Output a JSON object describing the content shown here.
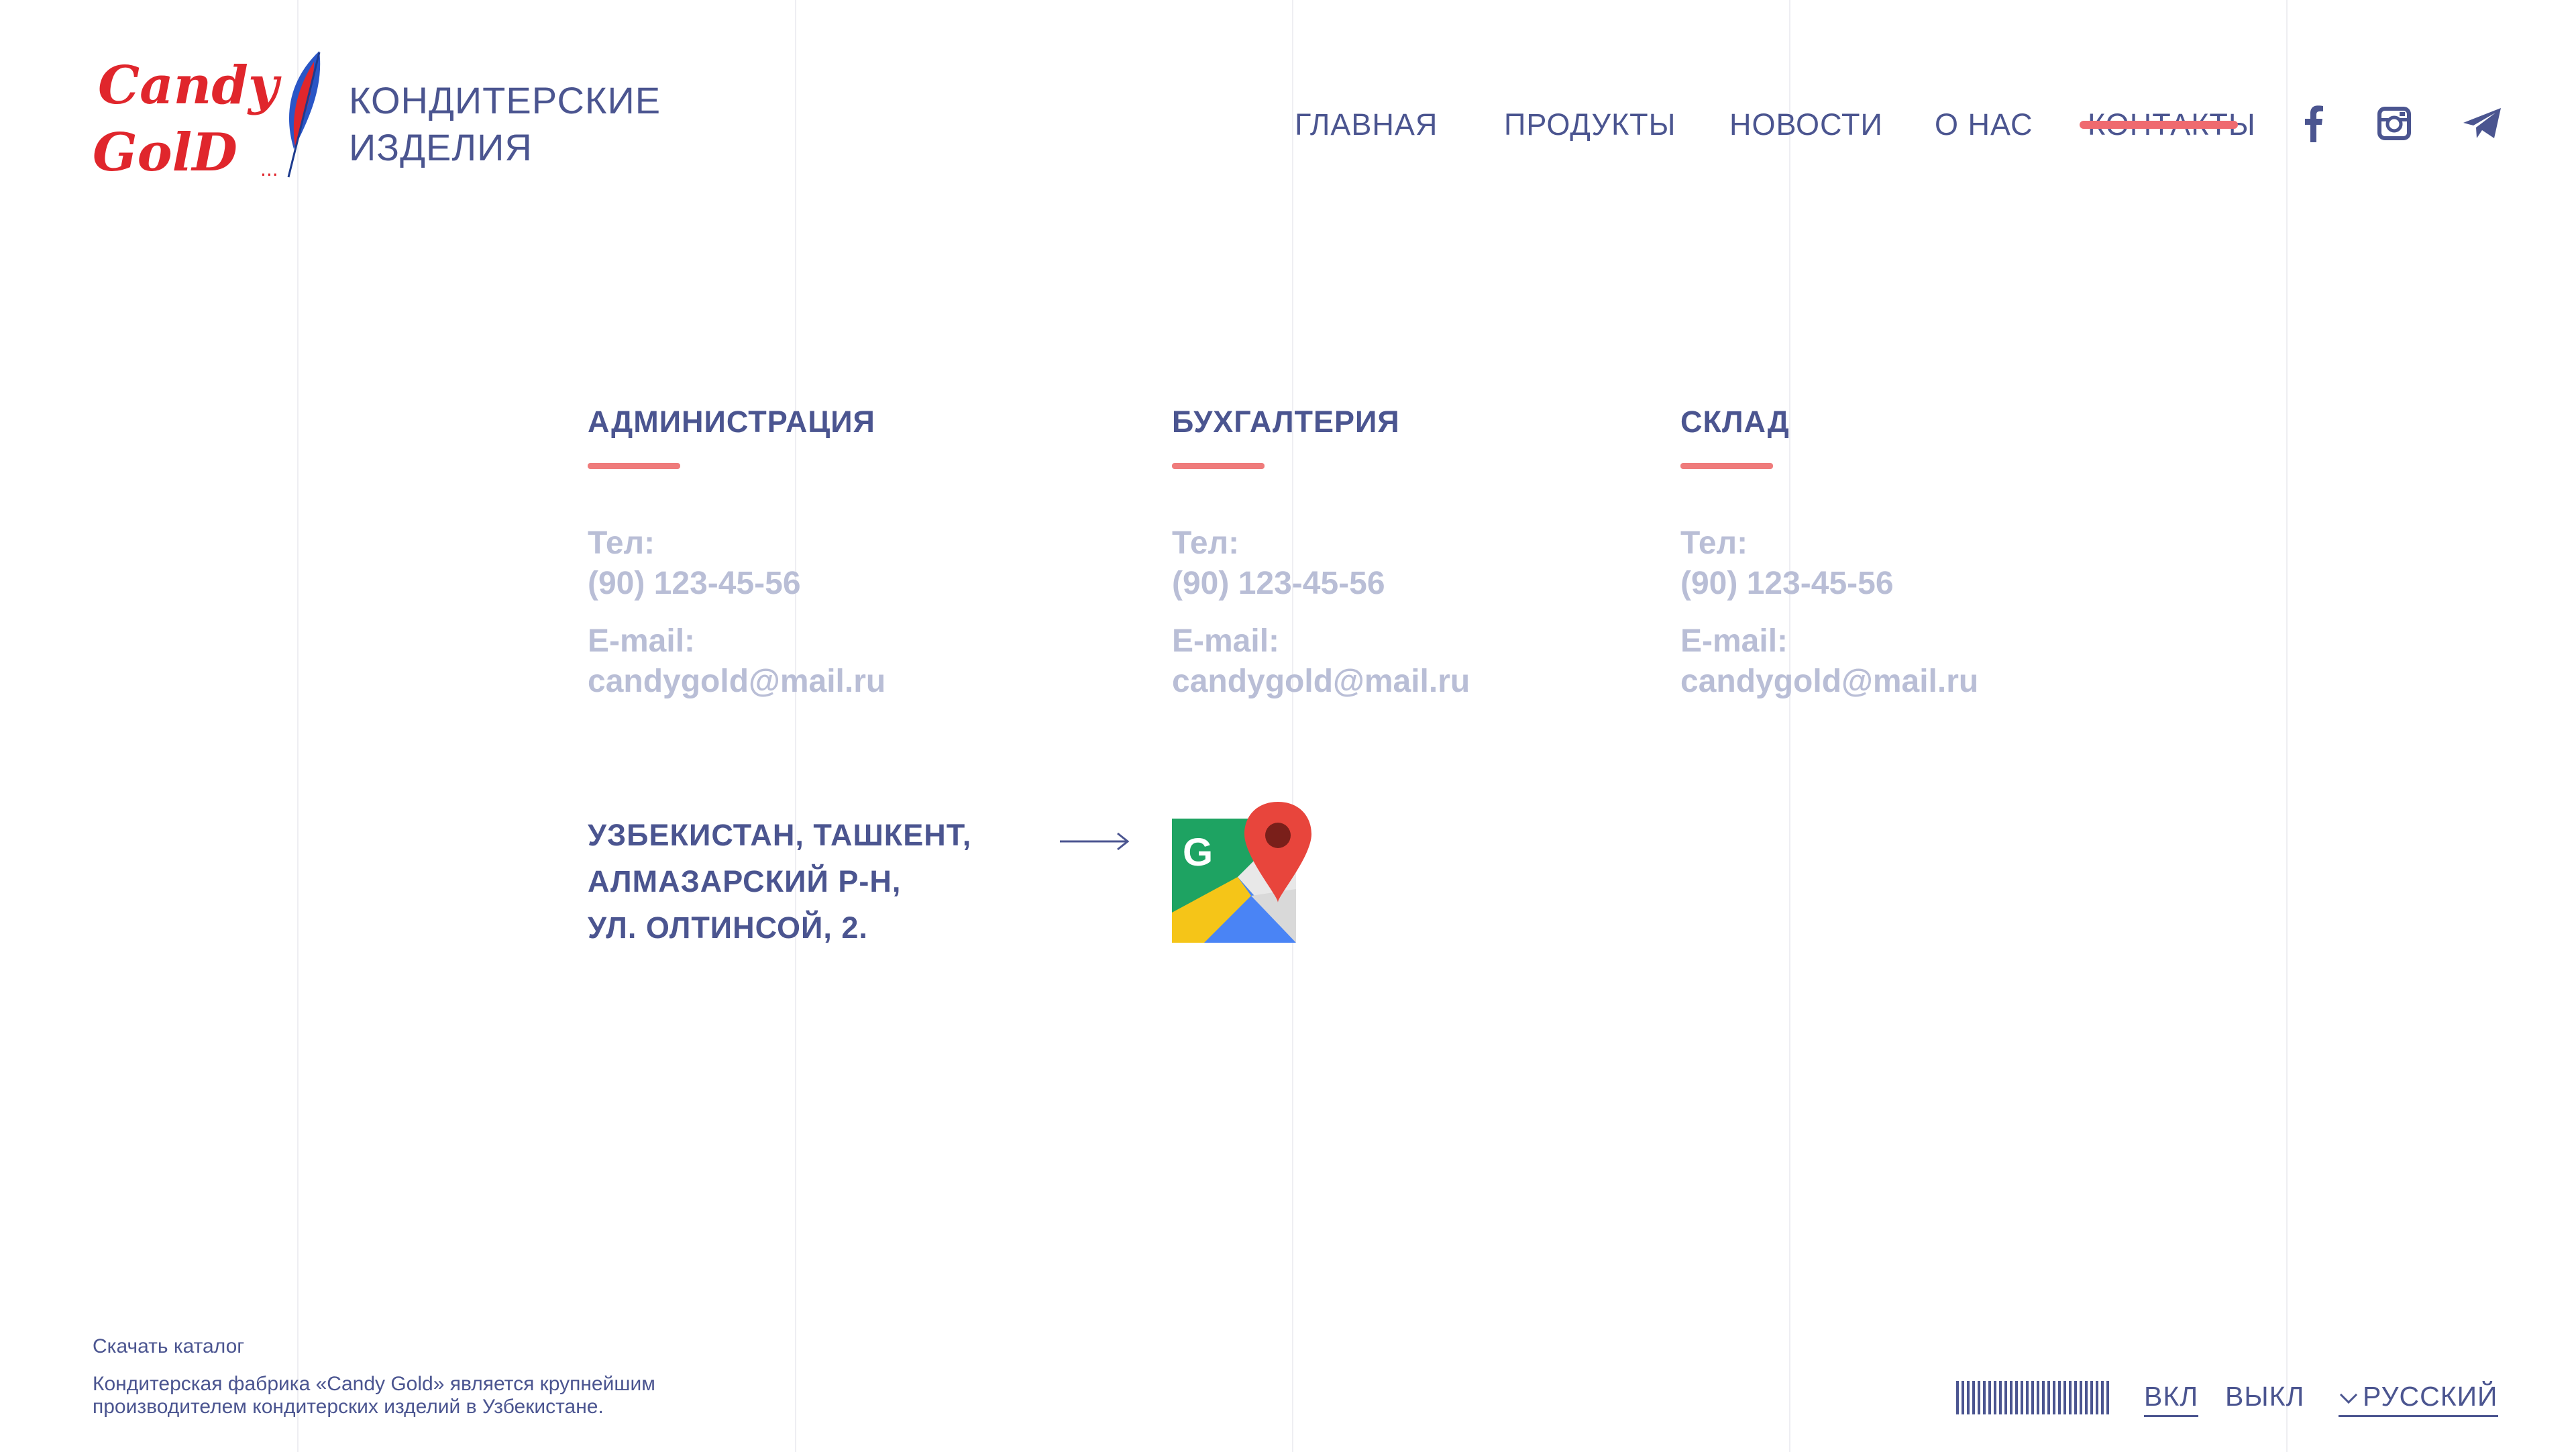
{
  "brand": {
    "logo_line1": "Candy",
    "logo_line2": "GolD",
    "title_line1": "КОНДИТЕРСКИЕ",
    "title_line2": "ИЗДЕЛИЯ"
  },
  "nav": {
    "items": [
      {
        "label": "ГЛАВНАЯ"
      },
      {
        "label": "ПРОДУКТЫ"
      },
      {
        "label": "НОВОСТИ"
      },
      {
        "label": "О НАС"
      },
      {
        "label": "КОНТАКТЫ"
      }
    ],
    "active": "КОНТАКТЫ"
  },
  "social": [
    {
      "icon": "facebook-icon"
    },
    {
      "icon": "instagram-icon"
    },
    {
      "icon": "telegram-icon"
    }
  ],
  "contacts": [
    {
      "dept": "АДМИНИСТРАЦИЯ",
      "tel_label": "Тел:",
      "tel": "(90) 123-45-56",
      "email_label": "E-mail:",
      "email": "candygold@mail.ru"
    },
    {
      "dept": "БУХГАЛТЕРИЯ",
      "tel_label": "Тел:",
      "tel": "(90) 123-45-56",
      "email_label": "E-mail:",
      "email": "candygold@mail.ru"
    },
    {
      "dept": "СКЛАД",
      "tel_label": "Тел:",
      "tel": "(90) 123-45-56",
      "email_label": "E-mail:",
      "email": "candygold@mail.ru"
    }
  ],
  "address": {
    "line1": "УЗБЕКИСТАН, ТАШКЕНТ,",
    "line2": "АЛМАЗАРСКИЙ Р-Н,",
    "line3": "УЛ. ОЛТИНСОЙ, 2."
  },
  "map_icon": "google-maps-icon",
  "footer": {
    "download": "Скачать каталог",
    "about_line1": "Кондитерская фабрика «Candy Gold» является крупнейшим",
    "about_line2": "производителем кондитерских изделий в Узбекистане.",
    "toggle_on": "ВКЛ",
    "toggle_off": "ВЫКЛ",
    "language": "РУССКИЙ"
  },
  "colors": {
    "primary": "#4b5590",
    "accent": "#ef6a6f",
    "muted": "#b9bed6",
    "logo_red": "#e0262c",
    "feather_blue": "#2a56c6"
  }
}
